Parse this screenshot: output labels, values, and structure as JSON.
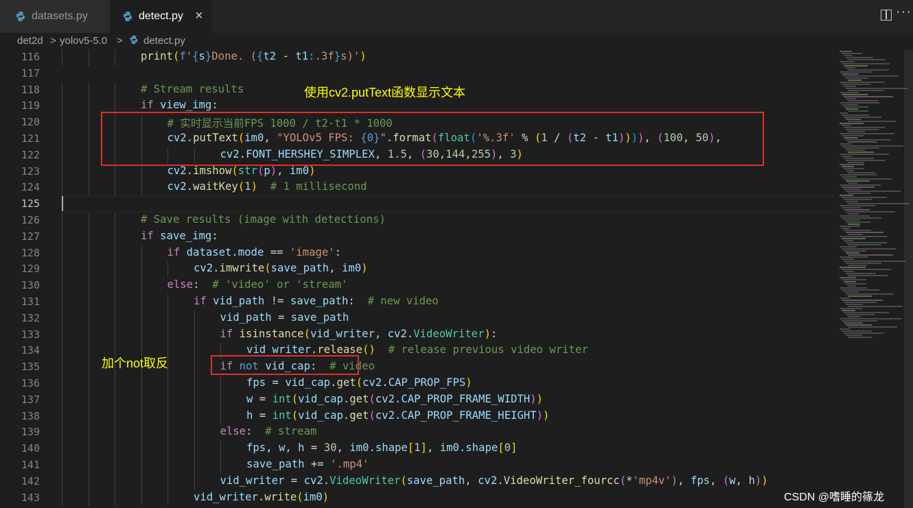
{
  "tabs": [
    {
      "label": "datasets.py",
      "active": false
    },
    {
      "label": "detect.py",
      "active": true
    }
  ],
  "close_glyph": "×",
  "breadcrumb": {
    "folder": "det2d",
    "subfolder": "yolov5-5.0",
    "file": "detect.py",
    "sep": ">"
  },
  "colors": {
    "box": "#e0302c",
    "annotation": "#ffff00",
    "comment": "#6a9955",
    "keyword": "#c586c0",
    "string": "#ce9178"
  },
  "icons": [
    "python-file-icon",
    "split-editor-icon",
    "more-actions-icon",
    "close-icon"
  ],
  "lines": [
    {
      "n": "116",
      "html": "<span class='c-fn'>print</span><span class='c-p1'>(</span><span class='c-kw2'>f</span><span class='c-str'>'</span><span class='c-kw2'>{</span><span class='c-var'>s</span><span class='c-kw2'>}</span><span class='c-str'>Done. (</span><span class='c-kw2'>{</span><span class='c-var'>t2</span> - <span class='c-var'>t1</span><span class='c-kw2'>:</span><span class='c-str'>.3f</span><span class='c-kw2'>}</span><span class='c-str'>s)'</span><span class='c-p1'>)</span>",
      "indent": 0
    },
    {
      "n": "117",
      "html": "",
      "indent": 0
    },
    {
      "n": "118",
      "html": "<span class='c-cm'># Stream results</span>",
      "indent": 0
    },
    {
      "n": "119",
      "html": "<span class='c-kw'>if</span> <span class='c-var'>view_img</span>:",
      "indent": 0
    },
    {
      "n": "120",
      "html": "<span class='c-cm'># 实时显示当前FPS 1000 / t2-t1 * 1000</span>",
      "indent": 1
    },
    {
      "n": "121",
      "html": "<span class='c-var'>cv2</span>.<span class='c-fn'>putText</span><span class='c-p1'>(</span><span class='c-var'>im0</span>, <span class='c-str'>\"YOLOv5 FPS: </span><span class='c-kw2'>{0}</span><span class='c-str'>\"</span>.<span class='c-fn'>format</span><span class='c-p2'>(</span><span class='c-cls'>float</span><span class='c-p3'>(</span><span class='c-str'>'%.3f'</span> % <span class='c-p1'>(</span><span class='c-num'>1</span> / <span class='c-p2'>(</span><span class='c-var'>t2</span> - <span class='c-var'>t1</span><span class='c-p2'>)</span><span class='c-p1'>)</span><span class='c-p3'>)</span><span class='c-p2'>)</span>, <span class='c-p2'>(</span><span class='c-num'>100</span>, <span class='c-num'>50</span><span class='c-p2'>)</span>,",
      "indent": 1
    },
    {
      "n": "122",
      "html": "<span class='c-var'>cv2</span>.<span class='c-var'>FONT_HERSHEY_SIMPLEX</span>, <span class='c-num'>1.5</span>, <span class='c-p2'>(</span><span class='c-num'>30</span>,<span class='c-num'>144</span>,<span class='c-num'>255</span><span class='c-p2'>)</span>, <span class='c-num'>3</span><span class='c-p1'>)</span>",
      "indent": 3
    },
    {
      "n": "123",
      "html": "<span class='c-var'>cv2</span>.<span class='c-fn'>imshow</span><span class='c-p1'>(</span><span class='c-cls'>str</span><span class='c-p2'>(</span><span class='c-var'>p</span><span class='c-p2'>)</span>, <span class='c-var'>im0</span><span class='c-p1'>)</span>",
      "indent": 1
    },
    {
      "n": "124",
      "html": "<span class='c-var'>cv2</span>.<span class='c-fn'>waitKey</span><span class='c-p1'>(</span><span class='c-num'>1</span><span class='c-p1'>)</span>  <span class='c-cm'># 1 millisecond</span>",
      "indent": 1
    },
    {
      "n": "125",
      "html": "",
      "indent": 0
    },
    {
      "n": "126",
      "html": "<span class='c-cm'># Save results (image with detections)</span>",
      "indent": 0
    },
    {
      "n": "127",
      "html": "<span class='c-kw'>if</span> <span class='c-var'>save_img</span>:",
      "indent": 0
    },
    {
      "n": "128",
      "html": "<span class='c-kw'>if</span> <span class='c-var'>dataset</span>.<span class='c-var'>mode</span> == <span class='c-str'>'image'</span>:",
      "indent": 1
    },
    {
      "n": "129",
      "html": "<span class='c-var'>cv2</span>.<span class='c-fn'>imwrite</span><span class='c-p1'>(</span><span class='c-var'>save_path</span>, <span class='c-var'>im0</span><span class='c-p1'>)</span>",
      "indent": 2
    },
    {
      "n": "130",
      "html": "<span class='c-kw'>else</span>:  <span class='c-cm'># 'video' or 'stream'</span>",
      "indent": 1
    },
    {
      "n": "131",
      "html": "<span class='c-kw'>if</span> <span class='c-var'>vid_path</span> != <span class='c-var'>save_path</span>:  <span class='c-cm'># new video</span>",
      "indent": 2
    },
    {
      "n": "132",
      "html": "<span class='c-var'>vid_path</span> = <span class='c-var'>save_path</span>",
      "indent": 3
    },
    {
      "n": "133",
      "html": "<span class='c-kw'>if</span> <span class='c-fn'>isinstance</span><span class='c-p1'>(</span><span class='c-var'>vid_writer</span>, <span class='c-var'>cv2</span>.<span class='c-cls'>VideoWriter</span><span class='c-p1'>)</span>:",
      "indent": 3
    },
    {
      "n": "134",
      "html": "<span class='c-var'>vid_writer</span>.<span class='c-fn'>release</span><span class='c-p1'>()</span>  <span class='c-cm'># release previous video writer</span>",
      "indent": 4
    },
    {
      "n": "135",
      "html": "<span class='c-kw'>if</span> <span class='c-kw2'>not</span> <span class='c-var'>vid_cap</span>:  <span class='c-cm'># video</span>",
      "indent": 3
    },
    {
      "n": "136",
      "html": "<span class='c-var'>fps</span> = <span class='c-var'>vid_cap</span>.<span class='c-fn'>get</span><span class='c-p1'>(</span><span class='c-var'>cv2</span>.<span class='c-var'>CAP_PROP_FPS</span><span class='c-p1'>)</span>",
      "indent": 4
    },
    {
      "n": "137",
      "html": "<span class='c-var'>w</span> = <span class='c-cls'>int</span><span class='c-p1'>(</span><span class='c-var'>vid_cap</span>.<span class='c-fn'>get</span><span class='c-p2'>(</span><span class='c-var'>cv2</span>.<span class='c-var'>CAP_PROP_FRAME_WIDTH</span><span class='c-p2'>)</span><span class='c-p1'>)</span>",
      "indent": 4
    },
    {
      "n": "138",
      "html": "<span class='c-var'>h</span> = <span class='c-cls'>int</span><span class='c-p1'>(</span><span class='c-var'>vid_cap</span>.<span class='c-fn'>get</span><span class='c-p2'>(</span><span class='c-var'>cv2</span>.<span class='c-var'>CAP_PROP_FRAME_HEIGHT</span><span class='c-p2'>)</span><span class='c-p1'>)</span>",
      "indent": 4
    },
    {
      "n": "139",
      "html": "<span class='c-kw'>else</span>:  <span class='c-cm'># stream</span>",
      "indent": 3
    },
    {
      "n": "140",
      "html": "<span class='c-var'>fps</span>, <span class='c-var'>w</span>, <span class='c-var'>h</span> = <span class='c-num'>30</span>, <span class='c-var'>im0</span>.<span class='c-var'>shape</span><span class='c-p1'>[</span><span class='c-num'>1</span><span class='c-p1'>]</span>, <span class='c-var'>im0</span>.<span class='c-var'>shape</span><span class='c-p1'>[</span><span class='c-num'>0</span><span class='c-p1'>]</span>",
      "indent": 4
    },
    {
      "n": "141",
      "html": "<span class='c-var'>save_path</span> += <span class='c-str'>'.mp4'</span>",
      "indent": 4
    },
    {
      "n": "142",
      "html": "<span class='c-var'>vid_writer</span> = <span class='c-var'>cv2</span>.<span class='c-cls'>VideoWriter</span><span class='c-p1'>(</span><span class='c-var'>save_path</span>, <span class='c-var'>cv2</span>.<span class='c-fn'>VideoWriter_fourcc</span><span class='c-p2'>(</span>*<span class='c-str'>'mp4v'</span><span class='c-p2'>)</span>, <span class='c-var'>fps</span>, <span class='c-p2'>(</span><span class='c-var'>w</span>, <span class='c-var'>h</span><span class='c-p2'>)</span><span class='c-p1'>)</span>",
      "indent": 3
    },
    {
      "n": "143",
      "html": "<span class='c-var'>vid_writer</span>.<span class='c-fn'>write</span><span class='c-p1'>(</span><span class='c-var'>im0</span><span class='c-p1'>)</span>",
      "indent": 2
    }
  ],
  "annotations": {
    "top": "使用cv2.putText函数显示文本",
    "bottom": "加个not取反"
  },
  "watermark": "CSDN @嗜睡的篠龙"
}
